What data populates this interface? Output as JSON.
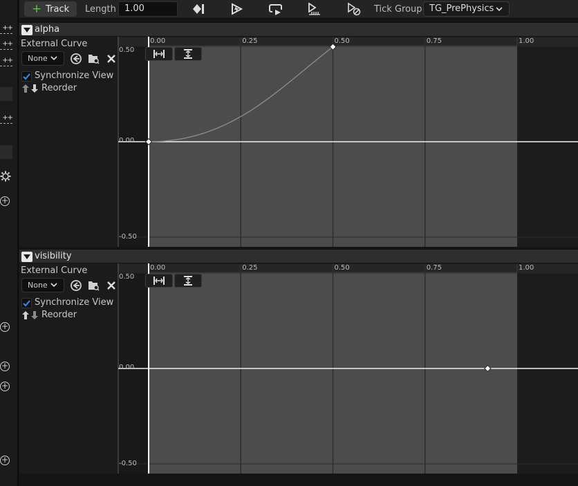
{
  "toolbar": {
    "add_track_label": "Track",
    "length_label": "Length",
    "length_value": "1.00",
    "tick_group_label": "Tick Group",
    "tick_group_value": "TG_PrePhysics",
    "icons": [
      "add-key-icon",
      "autoplay-icon",
      "loop-icon",
      "replicated-icon",
      "ignore-time-dilation-icon"
    ]
  },
  "left_strip": {
    "button_text": "++"
  },
  "tracks": [
    {
      "name": "alpha",
      "external_curve_label": "External Curve",
      "curve_select_value": "None",
      "synchronize_view_label": "Synchronize View",
      "synchronize_view_checked": true,
      "reorder_label": "Reorder",
      "x_ticks": [
        "0.00",
        "0.25",
        "0.50",
        "0.75",
        "1.00"
      ],
      "y_ticks": [
        "0.50",
        "0.00",
        "-0.50"
      ],
      "keys": [
        {
          "time": 0.0,
          "value": 0.0
        },
        {
          "time": 0.5,
          "value": 0.52
        }
      ]
    },
    {
      "name": "visibility",
      "external_curve_label": "External Curve",
      "curve_select_value": "None",
      "synchronize_view_label": "Synchronize View",
      "synchronize_view_checked": true,
      "reorder_label": "Reorder",
      "x_ticks": [
        "0.00",
        "0.25",
        "0.50",
        "0.75",
        "1.00"
      ],
      "y_ticks": [
        "0.50",
        "0.00",
        "-0.50"
      ],
      "keys": [
        {
          "time": 0.92,
          "value": 0.0
        }
      ]
    }
  ]
}
